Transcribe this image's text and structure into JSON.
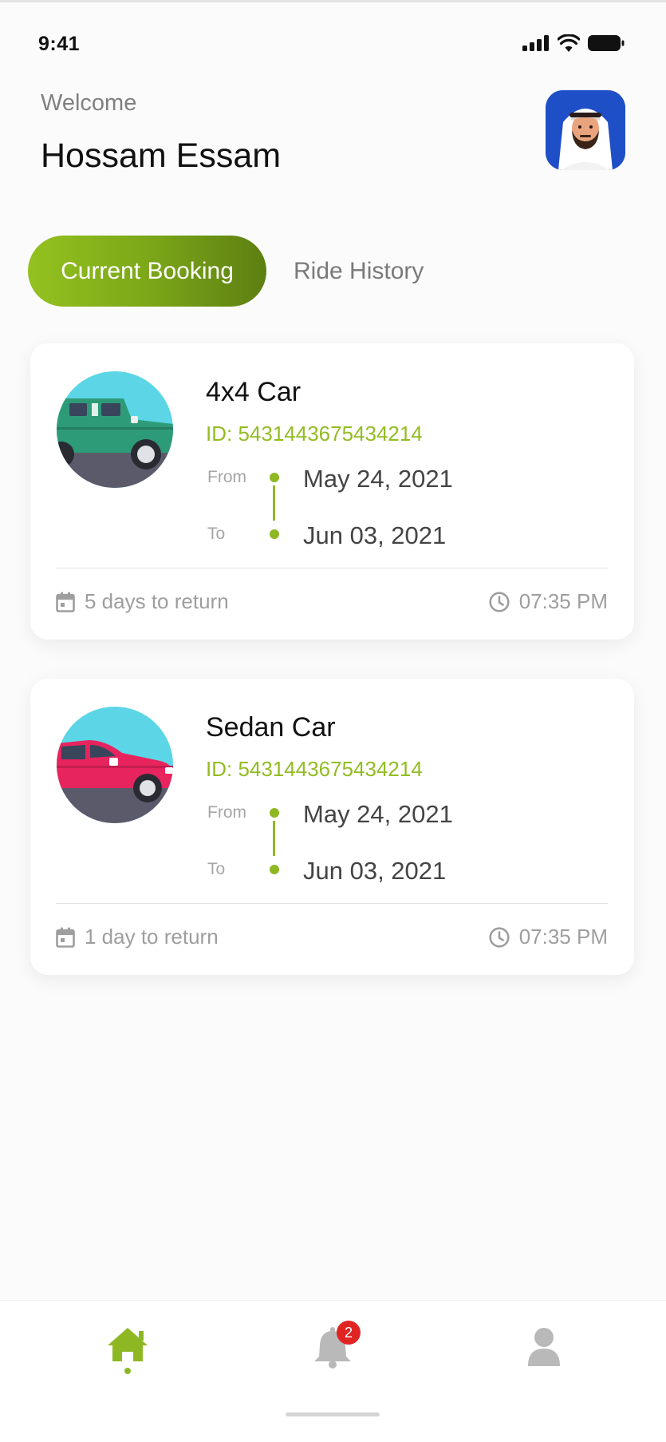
{
  "status_bar": {
    "time": "9:41"
  },
  "header": {
    "welcome": "Welcome",
    "user_name": "Hossam Essam"
  },
  "tabs": [
    {
      "label": "Current Booking",
      "active": true
    },
    {
      "label": "Ride History",
      "active": false
    }
  ],
  "bookings": [
    {
      "title": "4x4 Car",
      "id_text": "ID: 5431443675434214",
      "from_label": "From",
      "to_label": "To",
      "from_date": "May 24, 2021",
      "to_date": "Jun 03, 2021",
      "return_text": "5 days to return",
      "time": "07:35 PM",
      "car_color": "#2e9b78",
      "car_icon": "jeep-icon"
    },
    {
      "title": "Sedan Car",
      "id_text": "ID: 5431443675434214",
      "from_label": "From",
      "to_label": "To",
      "from_date": "May 24, 2021",
      "to_date": "Jun 03, 2021",
      "return_text": "1 day to return",
      "time": "07:35 PM",
      "car_color": "#e8245f",
      "car_icon": "sedan-icon"
    }
  ],
  "bottom_nav": {
    "items": [
      {
        "icon": "home-icon",
        "active": true
      },
      {
        "icon": "bell-icon",
        "active": false,
        "badge": "2"
      },
      {
        "icon": "user-icon",
        "active": false
      }
    ]
  },
  "colors": {
    "accent": "#8eb823",
    "accent_dark": "#5d7f12",
    "badge": "#e02424"
  }
}
